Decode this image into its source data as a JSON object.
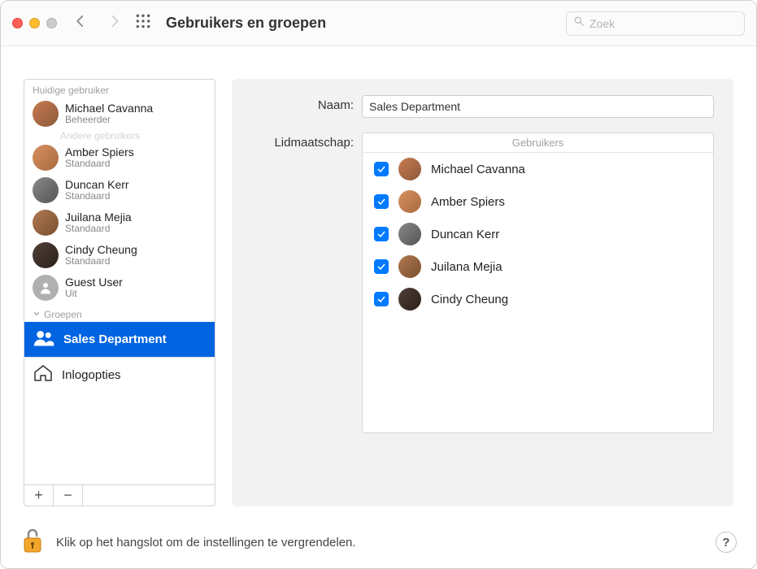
{
  "titlebar": {
    "title": "Gebruikers en groepen",
    "search_placeholder": "Zoek"
  },
  "sidebar": {
    "current_user_label": "Huidige gebruiker",
    "other_users_label": "Andere gebruikers",
    "groups_label": "Groepen",
    "login_options_label": "Inlogopties",
    "current_user": {
      "name": "Michael Cavanna",
      "role": "Beheerder"
    },
    "other_users": [
      {
        "name": "Amber Spiers",
        "role": "Standaard"
      },
      {
        "name": "Duncan Kerr",
        "role": "Standaard"
      },
      {
        "name": "Juilana Mejia",
        "role": "Standaard"
      },
      {
        "name": "Cindy Cheung",
        "role": "Standaard"
      },
      {
        "name": "Guest User",
        "role": "Uit"
      }
    ],
    "groups": [
      {
        "name": "Sales Department",
        "selected": true
      }
    ],
    "add_label": "+",
    "remove_label": "−"
  },
  "main": {
    "name_label": "Naam:",
    "name_value": "Sales Department",
    "membership_label": "Lidmaatschap:",
    "members_header": "Gebruikers",
    "members": [
      {
        "name": "Michael Cavanna",
        "checked": true
      },
      {
        "name": "Amber Spiers",
        "checked": true
      },
      {
        "name": "Duncan Kerr",
        "checked": true
      },
      {
        "name": "Juilana Mejia",
        "checked": true
      },
      {
        "name": "Cindy Cheung",
        "checked": true
      }
    ]
  },
  "footer": {
    "lock_text": "Klik op het hangslot om de instellingen te vergrendelen.",
    "help_label": "?"
  },
  "colors": {
    "accent": "#007aff",
    "selection": "#0064e1"
  }
}
